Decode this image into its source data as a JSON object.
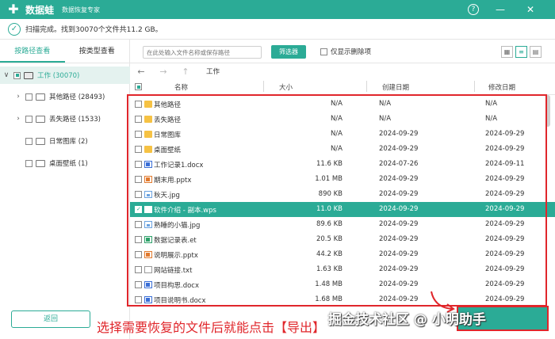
{
  "app": {
    "name": "数据蛙",
    "subtitle": "数据恢复专家",
    "logo": "plus-logo-icon"
  },
  "window": {
    "help": "?",
    "minimize": "—",
    "close": "✕"
  },
  "status": {
    "text": "扫描完成。找到30070个文件共11.2 GB。"
  },
  "tabs": [
    {
      "label": "按路径查看",
      "active": true
    },
    {
      "label": "按类型查看",
      "active": false
    }
  ],
  "tree": [
    {
      "label": "工作 (30070)",
      "icon": "drive-icon",
      "state": "partial",
      "expanded": true
    },
    {
      "label": "其他路径 (28493)",
      "icon": "folder-icon",
      "state": "unchecked",
      "expandable": true
    },
    {
      "label": "丢失路径 (1533)",
      "icon": "folder-icon",
      "state": "unchecked",
      "expandable": true
    },
    {
      "label": "日常图库 (2)",
      "icon": "folder-icon",
      "state": "unchecked"
    },
    {
      "label": "桌面壁纸 (1)",
      "icon": "folder-icon",
      "state": "unchecked"
    }
  ],
  "toolbar": {
    "search_placeholder": "在此处输入文件名称或保存路径",
    "filter_label": "筛选器",
    "deleted_only_label": "仅显示删除项"
  },
  "nav": {
    "back": "←",
    "forward": "→",
    "up": "↑",
    "crumb": "工作"
  },
  "columns": {
    "name": "名称",
    "size": "大小",
    "created": "创建日期",
    "modified": "修改日期"
  },
  "files": [
    {
      "name": "其他路径",
      "size": "N/A",
      "created": "N/A",
      "modified": "N/A",
      "type": "folder",
      "selected": false
    },
    {
      "name": "丢失路径",
      "size": "N/A",
      "created": "N/A",
      "modified": "N/A",
      "type": "folder",
      "selected": false
    },
    {
      "name": "日常图库",
      "size": "N/A",
      "created": "2024-09-29",
      "modified": "2024-09-29",
      "type": "folder",
      "selected": false
    },
    {
      "name": "桌面壁纸",
      "size": "N/A",
      "created": "2024-09-29",
      "modified": "2024-09-29",
      "type": "folder",
      "selected": false
    },
    {
      "name": "工作记录1.docx",
      "size": "11.6 KB",
      "created": "2024-07-26",
      "modified": "2024-09-11",
      "type": "docx",
      "selected": false
    },
    {
      "name": "期末用.pptx",
      "size": "1.01 MB",
      "created": "2024-09-29",
      "modified": "2024-09-29",
      "type": "pptx",
      "selected": false
    },
    {
      "name": "秋天.jpg",
      "size": "890 KB",
      "created": "2024-09-29",
      "modified": "2024-09-29",
      "type": "jpg",
      "selected": false
    },
    {
      "name": "软件介绍 - 副本.wps",
      "size": "11.0 KB",
      "created": "2024-09-29",
      "modified": "2024-09-29",
      "type": "wps",
      "selected": true
    },
    {
      "name": "熟睡的小猫.jpg",
      "size": "89.6 KB",
      "created": "2024-09-29",
      "modified": "2024-09-29",
      "type": "jpg",
      "selected": false
    },
    {
      "name": "数据记录表.et",
      "size": "20.5 KB",
      "created": "2024-09-29",
      "modified": "2024-09-29",
      "type": "et",
      "selected": false
    },
    {
      "name": "说明展示.pptx",
      "size": "44.2 KB",
      "created": "2024-09-29",
      "modified": "2024-09-29",
      "type": "pptx",
      "selected": false
    },
    {
      "name": "网站链接.txt",
      "size": "1.63 KB",
      "created": "2024-09-29",
      "modified": "2024-09-29",
      "type": "txt",
      "selected": false
    },
    {
      "name": "项目构思.docx",
      "size": "1.48 MB",
      "created": "2024-09-29",
      "modified": "2024-09-29",
      "type": "docx",
      "selected": false
    },
    {
      "name": "项目说明书.docx",
      "size": "1.68 MB",
      "created": "2024-09-29",
      "modified": "2024-09-29",
      "type": "docx",
      "selected": false
    }
  ],
  "back_button": "返回",
  "annotation": "选择需要恢复的文件后就能点击【导出】",
  "watermark": "掘金技术社区 @ 小明助手",
  "colors": {
    "accent": "#2bab96",
    "highlight": "#e0262b"
  }
}
